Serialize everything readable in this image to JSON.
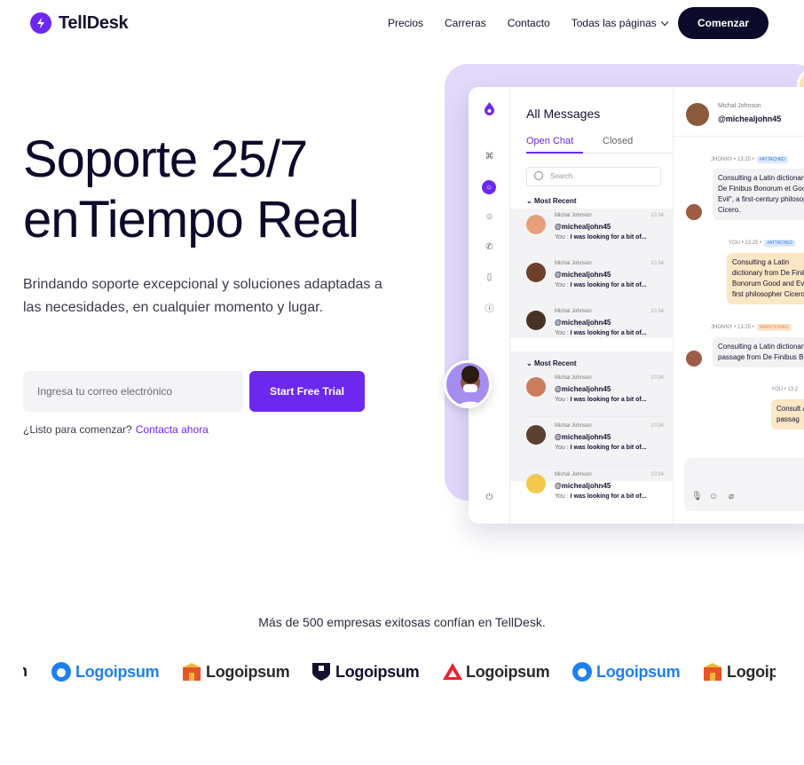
{
  "brand": {
    "name": "TellDesk",
    "accent": "#6d28f0",
    "dark": "#0c0a2a"
  },
  "nav": {
    "links": [
      "Precios",
      "Carreras",
      "Contacto"
    ],
    "dropdown_label": "Todas las páginas",
    "cta": "Comenzar"
  },
  "hero": {
    "title_line1": "Soporte 25/7",
    "title_line2_a": "en",
    "title_line2_b": "Tiempo Real",
    "subtitle": "Brindando soporte excepcional y soluciones adaptadas a las necesidades, en cualquier momento y lugar.",
    "email_placeholder": "Ingresa tu correo electrónico",
    "cta": "Start Free Trial",
    "ready_text": "¿Listo para comenzar?",
    "ready_link": "Contacta ahora"
  },
  "app": {
    "list_title": "All Messages",
    "tab_open": "Open Chat",
    "tab_closed": "Closed",
    "search_placeholder": "Search",
    "section1": "Most Recent",
    "section2": "Most Recent",
    "messages": [
      {
        "name": "Michal Johnson",
        "handle": "@michealjohn45",
        "preview_you": "You :",
        "preview": "I was looking for a bit of...",
        "time": "10:34",
        "color": "#e8a07a"
      },
      {
        "name": "Michal Johnson",
        "handle": "@michealjohn45",
        "preview_you": "You :",
        "preview": "I was looking for a bit of...",
        "time": "10:34",
        "color": "#6b3f2a"
      },
      {
        "name": "Michal Johnson",
        "handle": "@michealjohn45",
        "preview_you": "You :",
        "preview": "I was looking for a bit of...",
        "time": "10:34",
        "color": "#4a3226"
      },
      {
        "name": "Michal Johnson",
        "handle": "@michealjohn45",
        "preview_you": "You :",
        "preview": "I was looking for a bit of...",
        "time": "10:34",
        "color": "#c97d5c"
      },
      {
        "name": "Michal Johnson",
        "handle": "@michealjohn45",
        "preview_you": "You :",
        "preview": "I was looking for a bit of...",
        "time": "10:34",
        "color": "#5a4030"
      },
      {
        "name": "Michal Johnson",
        "handle": "@michealjohn45",
        "preview_you": "You :",
        "preview": "I was looking for a bit of...",
        "time": "10:34",
        "color": "#f2c94c"
      }
    ],
    "chat_header": {
      "name": "Michal Johnson",
      "handle": "@michealjohn45"
    },
    "chat": {
      "m1_meta": "JHONNY • 13:25 •",
      "m1_tag": "#ATTACHED",
      "m1_text": "Consulting a Latin dictionary from De Finibus Bonorum et Good and Evil\", a first-century philosopher Cicero.",
      "m2_meta": "YOU • 13:25 •",
      "m2_tag": "#ATTACHED",
      "m2_text": "Consulting a Latin dictionary from De Finibus Bonorum Good and Evil\", a first philosopher Cicero.",
      "m3_meta": "JHONNY • 13:25 •",
      "m3_tag": "#MENTIONED",
      "m3_text": "Consulting a Latin dictionary passage from De Finibus Bonorum",
      "m4_meta": "YOU • 13:2",
      "m4_text": "Consult a passag"
    }
  },
  "trust": {
    "text": "Más de 500 empresas exitosas confían en TellDesk.",
    "logos": [
      {
        "label": "n",
        "color": "#14122e",
        "icon": "partial-logo"
      },
      {
        "label": "Logoipsum",
        "color": "#1e7ff0",
        "icon": "blue-circle-icon"
      },
      {
        "label": "Logoipsum",
        "color": "#2a2a2a",
        "icon": "orange-house-icon"
      },
      {
        "label": "Logoipsum",
        "color": "#14122e",
        "icon": "dark-shield-icon"
      },
      {
        "label": "Logoipsum",
        "color": "#2a2a2a",
        "icon": "red-triangle-icon"
      },
      {
        "label": "Logoipsum",
        "color": "#1e7ff0",
        "icon": "blue-circle-icon"
      },
      {
        "label": "Logoip",
        "color": "#2a2a2a",
        "icon": "orange-house-icon"
      }
    ]
  }
}
